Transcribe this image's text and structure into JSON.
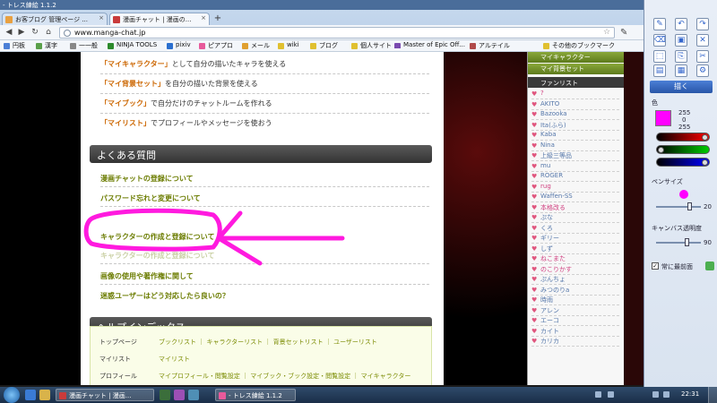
{
  "window": {
    "title": "- トレス練絵 1.1.2"
  },
  "tabs": [
    {
      "label": "お客ブログ 管理ページ ...",
      "active": false
    },
    {
      "label": "漫画チャット | 漫画の...",
      "active": true
    }
  ],
  "toolbar": {
    "url": "www.manga-chat.jp"
  },
  "bookmarks": [
    "円板",
    "漢字",
    "一一般",
    "NINJA TOOLS",
    "pixiv",
    "ピアプロ",
    "メール",
    "wiki",
    "ブログ",
    "個人サイト",
    "Master of Epic Off...",
    "アルテイル",
    "その他のブックマーク"
  ],
  "features": [
    {
      "hl": "「マイキャラクター」",
      "text": "として自分の描いたキャラを使える"
    },
    {
      "hl": "「マイ背景セット」",
      "text": "を自分の描いた背景を使える"
    },
    {
      "hl": "「マイブック」",
      "text": "で自分だけのチャットルームを作れる"
    },
    {
      "hl": "「マイリスト」",
      "text": "でプロフィールやメッセージを使おう"
    }
  ],
  "faq": {
    "title": "よくある質問",
    "links": [
      "漫画チャットの登録について",
      "パスワード忘れと変更について",
      "キャラクターの作成と登録について",
      "画像の使用や著作権に関して",
      "迷惑ユーザーはどう対応したら良いの？"
    ],
    "hidden_link": "キャラクターの作成と登録について"
  },
  "help": {
    "title": "ヘルプインデックス",
    "rows": [
      {
        "label": "トップページ",
        "links": "ブックリスト ｜ キャラクターリスト ｜ 背景セットリスト ｜ ユーザーリスト"
      },
      {
        "label": "マイリスト",
        "links": "マイリスト"
      },
      {
        "label": "プロフィール",
        "links": "マイプロフィール・閲覧設定 ｜ マイブック・ブック設定・閲覧設定 ｜ マイキャラクター"
      }
    ]
  },
  "sidebar": {
    "banners": [
      "マイキャラクター",
      "マイ背景セット"
    ],
    "fan_header": "ファンリスト",
    "fans": [
      "?",
      "AKITO",
      "Bazooka",
      "Ita(ふら)",
      "Kaba",
      "Nina",
      "上級三等品",
      "mu",
      "ROGER",
      "rug",
      "Waffen-SS",
      "本格改る",
      "ぷな",
      "くろ",
      "ギリー",
      "しず",
      "ねこまた",
      "のこりかす",
      "ぷんちょ",
      "みつのりa",
      "時雨",
      "アレン",
      "エーコ",
      "カイト",
      "カリカ"
    ]
  },
  "panel": {
    "draw_label": "描く",
    "color_label": "色",
    "rgb": [
      "255",
      "0",
      "255"
    ],
    "pen_size_label": "ペンサイズ",
    "pen_size": "20",
    "opacity_label": "キャンバス透明度",
    "opacity": "90",
    "always_front": "常に最前面"
  },
  "taskbar": {
    "tasks": [
      "漫画チャット | 漫画...",
      "- トレス練絵 1.1.2"
    ],
    "time": "22:31"
  },
  "colors": {
    "annotation": "#ff1adf",
    "accent": "#cc6600",
    "link_green": "#6b7c00",
    "picked_color": "#ff00ff"
  }
}
